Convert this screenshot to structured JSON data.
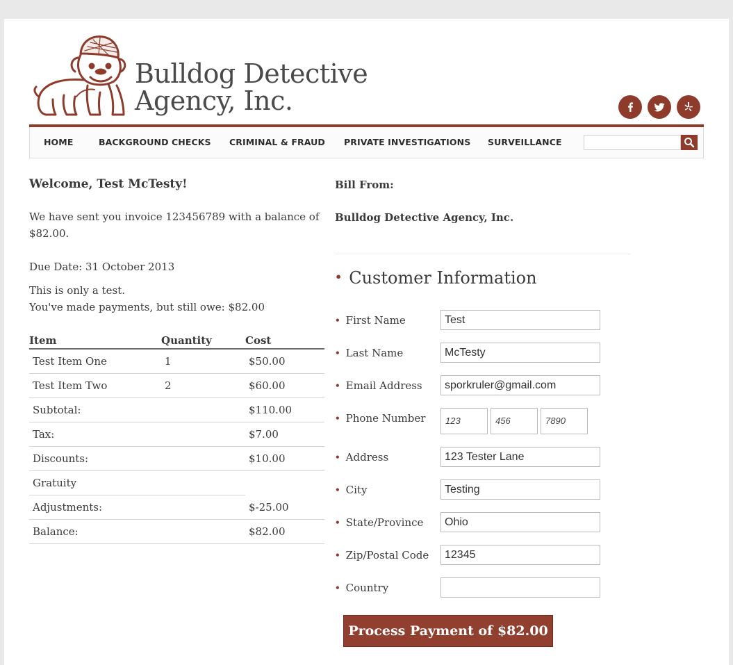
{
  "brand": {
    "line1": "Bulldog Detective",
    "line2": "Agency, Inc.",
    "accent_color": "#8e3b2c"
  },
  "social": [
    {
      "icon": "facebook-icon"
    },
    {
      "icon": "twitter-icon"
    },
    {
      "icon": "yelp-icon"
    }
  ],
  "nav": {
    "items": [
      {
        "label": "HOME"
      },
      {
        "label": "BACKGROUND CHECKS"
      },
      {
        "label": "CRIMINAL & FRAUD"
      },
      {
        "label": "PRIVATE INVESTIGATIONS"
      },
      {
        "label": "SURVEILLANCE"
      }
    ],
    "search_value": "",
    "search_icon": "search-icon"
  },
  "intro": {
    "welcome": "Welcome, Test McTesty!",
    "sent_line1": "We have sent you invoice 123456789 with a balance of",
    "sent_line2": "$82.00.",
    "due_date": "Due Date: 31 October 2013",
    "note": "This is only a test.",
    "owe": "You've made payments, but still owe: $82.00"
  },
  "invoice": {
    "headers": {
      "item": "Item",
      "quantity": "Quantity",
      "cost": "Cost"
    },
    "rows": [
      {
        "item": "Test Item One",
        "quantity": "1",
        "cost": "$50.00"
      },
      {
        "item": "Test Item Two",
        "quantity": "2",
        "cost": "$60.00"
      }
    ],
    "summary": [
      {
        "label": "Subtotal:",
        "value": "$110.00"
      },
      {
        "label": "Tax:",
        "value": "$7.00"
      },
      {
        "label": "Discounts:",
        "value": "$10.00"
      },
      {
        "label": "Gratuity",
        "value": ""
      },
      {
        "label": "Adjustments:",
        "value": "$-25.00"
      },
      {
        "label": "Balance:",
        "value": "$82.00"
      }
    ]
  },
  "bill_from": {
    "heading": "Bill From:",
    "name": "Bulldog Detective Agency, Inc."
  },
  "customer": {
    "title": "Customer Information",
    "bullet": "•",
    "first_name": {
      "label": "First Name",
      "value": "Test"
    },
    "last_name": {
      "label": "Last Name",
      "value": "McTesty"
    },
    "email": {
      "label": "Email Address",
      "value": "sporkruler@gmail.com"
    },
    "phone": {
      "label": "Phone Number",
      "part1": "123",
      "part2": "456",
      "part3": "7890"
    },
    "address": {
      "label": "Address",
      "value": "123 Tester Lane"
    },
    "city": {
      "label": "City",
      "value": "Testing"
    },
    "state": {
      "label": "State/Province",
      "value": "Ohio"
    },
    "zip": {
      "label": "Zip/Postal Code",
      "value": "12345"
    },
    "country": {
      "label": "Country",
      "value": ""
    }
  },
  "pay_button": "Process Payment of $82.00"
}
